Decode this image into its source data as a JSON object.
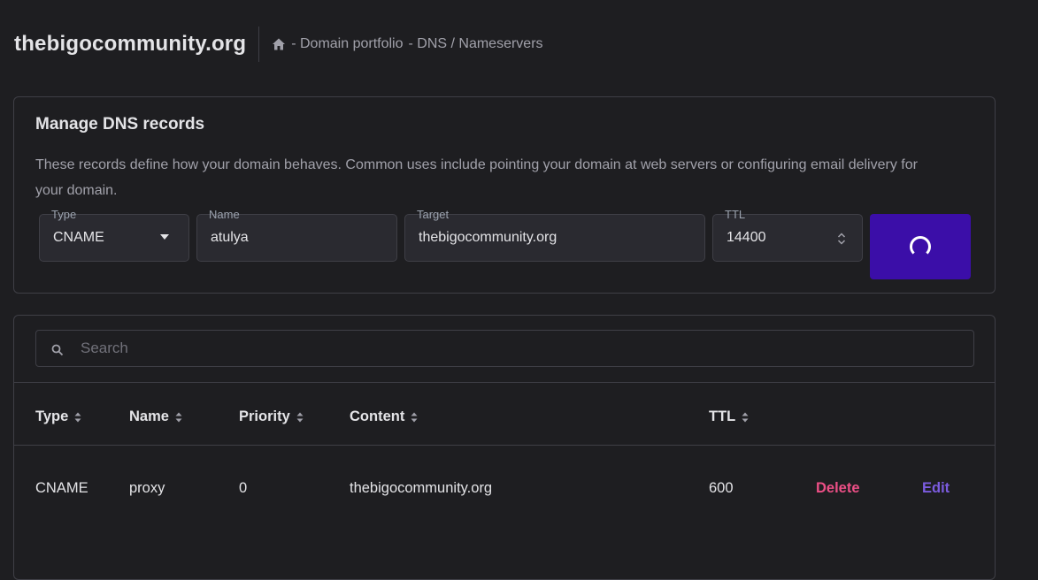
{
  "header": {
    "site_title": "thebigocommunity.org",
    "breadcrumb_1": "- Domain portfolio",
    "breadcrumb_2": "- DNS / Nameservers"
  },
  "manage": {
    "title": "Manage DNS records",
    "description": "These records define how your domain behaves. Common uses include pointing your domain at web servers or configuring email delivery for your domain.",
    "type_label": "Type",
    "type_value": "CNAME",
    "name_label": "Name",
    "name_value": "atulya",
    "target_label": "Target",
    "target_value": "thebigocommunity.org",
    "ttl_label": "TTL",
    "ttl_value": "14400"
  },
  "search": {
    "placeholder": "Search"
  },
  "table": {
    "columns": [
      "Type",
      "Name",
      "Priority",
      "Content",
      "TTL"
    ],
    "rows": [
      {
        "type": "CNAME",
        "name": "proxy",
        "priority": "0",
        "content": "thebigocommunity.org",
        "ttl": "600",
        "delete_label": "Delete",
        "edit_label": "Edit"
      }
    ]
  },
  "colors": {
    "background": "#1e1e21",
    "accent": "#3b0ea8",
    "delete": "#ec4f86",
    "edit": "#7c5ce0"
  }
}
